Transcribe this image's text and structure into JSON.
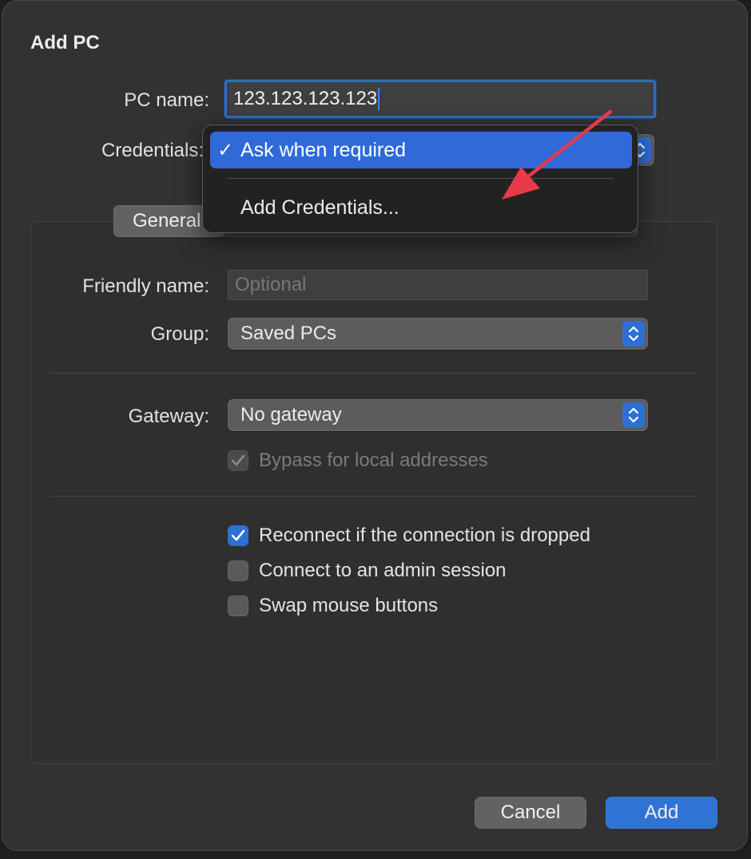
{
  "dialog": {
    "title": "Add PC",
    "pc_name_label": "PC name:",
    "pc_name_value": "123.123.123.123",
    "credentials_label": "Credentials:",
    "tab_general": "General",
    "friendly_label": "Friendly name:",
    "friendly_placeholder": "Optional",
    "group_label": "Group:",
    "group_value": "Saved PCs",
    "gateway_label": "Gateway:",
    "gateway_value": "No gateway",
    "bypass_label": "Bypass for local addresses",
    "options": [
      {
        "label": "Reconnect if the connection is dropped",
        "checked": true
      },
      {
        "label": "Connect to an admin session",
        "checked": false
      },
      {
        "label": "Swap mouse buttons",
        "checked": false
      }
    ],
    "cancel_label": "Cancel",
    "add_label": "Add"
  },
  "credentials_menu": {
    "items": [
      {
        "label": "Ask when required",
        "selected": true
      },
      {
        "label": "Add Credentials...",
        "selected": false
      }
    ]
  },
  "colors": {
    "accent": "#2f6ad8",
    "annotation_arrow": "#e8394a"
  }
}
